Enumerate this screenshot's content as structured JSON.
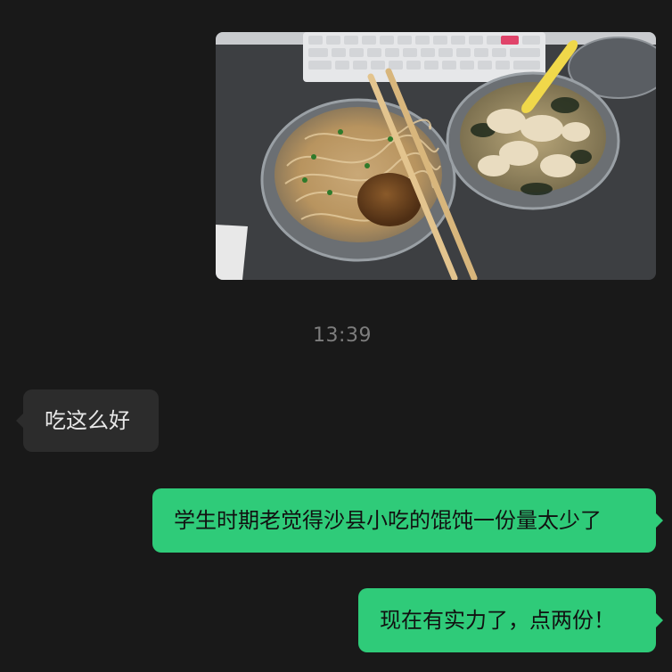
{
  "chat": {
    "image_message": {
      "type": "photo",
      "icon": "food-photo"
    },
    "timestamp": "13:39",
    "messages": [
      {
        "direction": "incoming",
        "text": "吃这么好"
      },
      {
        "direction": "outgoing",
        "text": "学生时期老觉得沙县小吃的馄饨一份量太少了"
      },
      {
        "direction": "outgoing",
        "text": "现在有实力了，点两份！"
      }
    ]
  },
  "colors": {
    "background": "#191919",
    "incoming_bubble": "#2c2c2c",
    "outgoing_bubble": "#2fcb79",
    "timestamp_text": "#7d7d7d"
  }
}
